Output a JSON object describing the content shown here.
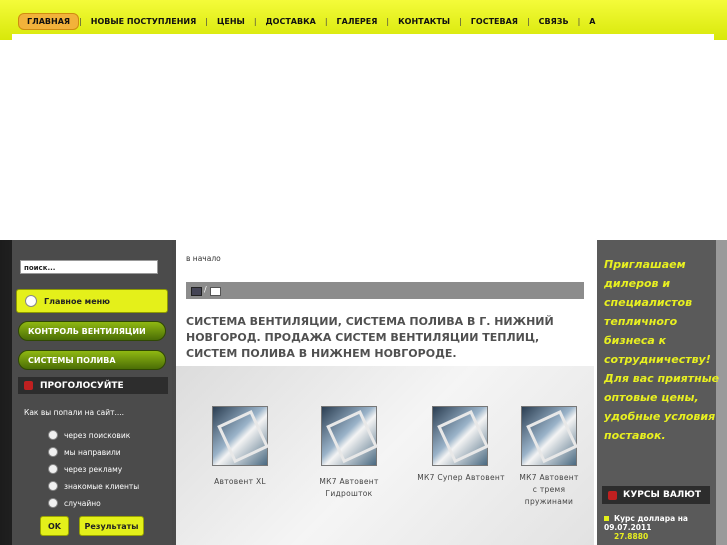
{
  "topnav": {
    "items": [
      "ГЛАВНАЯ",
      "НОВЫЕ ПОСТУПЛЕНИЯ",
      "ЦЕНЫ",
      "ДОСТАВКА",
      "ГАЛЕРЕЯ",
      "КОНТАКТЫ",
      "ГОСТЕВАЯ",
      "СВЯЗЬ",
      "А"
    ],
    "separator": "|"
  },
  "sidebar": {
    "search_placeholder": "поиск...",
    "main_menu": "Главное меню",
    "menu_items": [
      "КОНТРОЛЬ ВЕНТИЛЯЦИИ",
      "СИСТЕМЫ ПОЛИВА"
    ],
    "poll": {
      "heading": "ПРОГОЛОСУЙТЕ",
      "question": "Как вы попали на сайт....",
      "options": [
        "через поисковик",
        "мы направили",
        "через рекламу",
        "знакомые клиенты",
        "случайно"
      ],
      "ok_label": "OK",
      "results_label": "Результаты"
    }
  },
  "content": {
    "breadcrumb": "в начало",
    "iconbar_separator": "/",
    "title": "СИСТЕМА ВЕНТИЛЯЦИИ, СИСТЕМА ПОЛИВА В Г. НИЖНИЙ НОВГОРОД. ПРОДАЖА СИСТЕМ ВЕНТИЛЯЦИИ ТЕПЛИЦ, СИСТЕМ ПОЛИВА В НИЖНЕМ НОВГОРОДЕ.",
    "products": [
      "Автовент XL",
      "МК7 Автовент Гидрошток",
      "МК7 Супер Автовент",
      "МК7 Автовент с тремя пружинами"
    ]
  },
  "right": {
    "promo": "Приглашаем дилеров и специалистов тепличного бизнеса к сотрудничеству! Для вас приятные оптовые цены, удобные условия поставок.",
    "rates_heading": "КУРСЫ ВАЛЮТ",
    "rate_label": "Курс доллара на 09.07.2011",
    "rate_value": "27.8880"
  },
  "colors": {
    "accent_yellow": "#e4f01a",
    "menu_green": "#6f9410",
    "promo_text": "#e8f020"
  }
}
